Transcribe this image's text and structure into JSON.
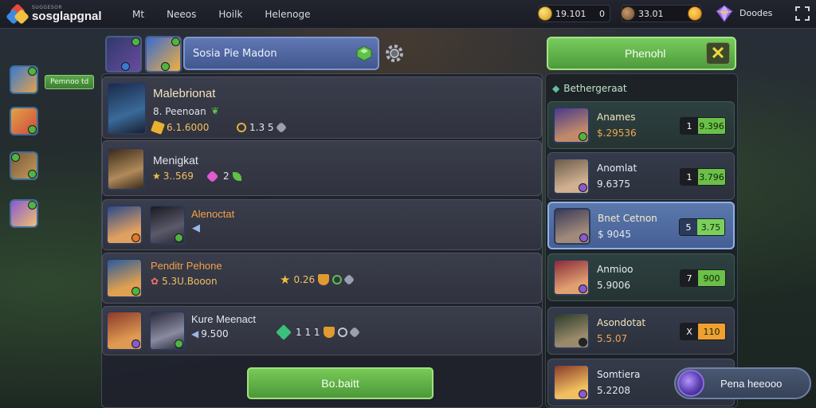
{
  "topbar": {
    "logo_sub": "SUGGESOR",
    "logo_title": "sosglapgnal",
    "nav": [
      "Mt",
      "Neeos",
      "Hoilk",
      "Helenoge"
    ],
    "gold": "19.101",
    "gold_extra": "0",
    "gems": "33.01",
    "currency_label": "Doodes"
  },
  "side": {
    "label": "Pemnoo td"
  },
  "header": {
    "search_text": "Sosia Pie Madon",
    "claim_label": "Phenohl",
    "close_glyph": "✕"
  },
  "cards": [
    {
      "title": "Malebrionat",
      "sub": "8. Peenoan",
      "stat1": "6.1.6000",
      "stat2": "1.3 5"
    },
    {
      "title": "Menigkat",
      "stat1": "3..569",
      "stat2": "2"
    },
    {
      "title": "Alenoctat",
      "stat1": ""
    },
    {
      "title": "Penditr Pehone",
      "stat1": "5.3U.Booon",
      "stat2": "0.26",
      "stat3": ""
    },
    {
      "title": "Kure Meenact",
      "stat1": "9.500",
      "stat2": "1 1 1"
    }
  ],
  "bottom_button": "Bo.baitt",
  "right": {
    "title": "Bethergeraat",
    "items": [
      {
        "name": "Anames",
        "price": "$.29536",
        "q": "1",
        "v": "9.396"
      },
      {
        "name": "Anomlat",
        "price": "9.6375",
        "q": "1",
        "v": "3.796"
      },
      {
        "name": "Bnet Cetnon",
        "price": "$ 9045",
        "q": "5",
        "v": "3.75"
      },
      {
        "name": "Anmioo",
        "price": "5.9006",
        "q": "7",
        "v": "900"
      },
      {
        "name": "Asondotat",
        "price": "5.5.07",
        "q": "X",
        "v": "110"
      },
      {
        "name": "Somtiera",
        "price": "5.2208"
      }
    ],
    "chat_label": "Pena heeooo"
  },
  "colors": {
    "accent_green": "#5aa64a",
    "accent_blue": "#5b79ad",
    "gold_text": "#f0a850"
  }
}
